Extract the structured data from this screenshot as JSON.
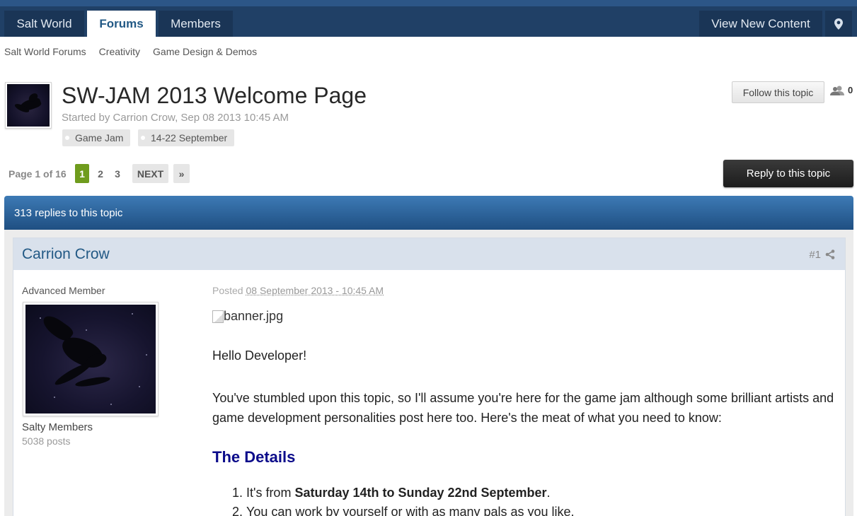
{
  "nav": {
    "tabs": [
      {
        "label": "Salt World"
      },
      {
        "label": "Forums"
      },
      {
        "label": "Members"
      }
    ],
    "view_new_content": "View New Content",
    "location_icon": "map-pin-icon"
  },
  "breadcrumb": [
    "Salt World Forums",
    "Creativity",
    "Game Design & Demos"
  ],
  "topic": {
    "title": "SW-JAM 2013 Welcome Page",
    "meta": "Started by Carrion Crow, Sep 08 2013 10:45 AM",
    "tags": [
      "Game Jam",
      "14-22 September"
    ],
    "follow_label": "Follow this topic",
    "followers_count": "0"
  },
  "pagination": {
    "label": "Page 1 of 16",
    "pages": [
      "1",
      "2",
      "3"
    ],
    "next": "NEXT",
    "last": "»"
  },
  "reply_button": "Reply to this topic",
  "replies_bar": "313 replies to this topic",
  "post": {
    "author": "Carrion Crow",
    "number": "#1",
    "rank": "Advanced Member",
    "group": "Salty Members",
    "posts": "5038 posts",
    "posted_prefix": "Posted ",
    "posted_date": "08 September 2013 - 10:45 AM",
    "banner_alt": "banner.jpg",
    "greeting": "Hello Developer!",
    "intro": "You've stumbled upon this topic, so I'll assume you're here for the game jam although some brilliant artists and game development personalities post here too. Here's the meat of what you need to know:",
    "details_heading": "The Details",
    "item1_pre": "It's from ",
    "item1_bold": "Saturday 14th to Sunday 22nd September",
    "item1_post": ".",
    "item2": "You can work by yourself or with as many pals as you like."
  },
  "colors": {
    "nav_bg": "#204066",
    "accent_blue": "#225985",
    "active_page": "#6f9c1d",
    "details_heading": "#0b0b8a"
  }
}
